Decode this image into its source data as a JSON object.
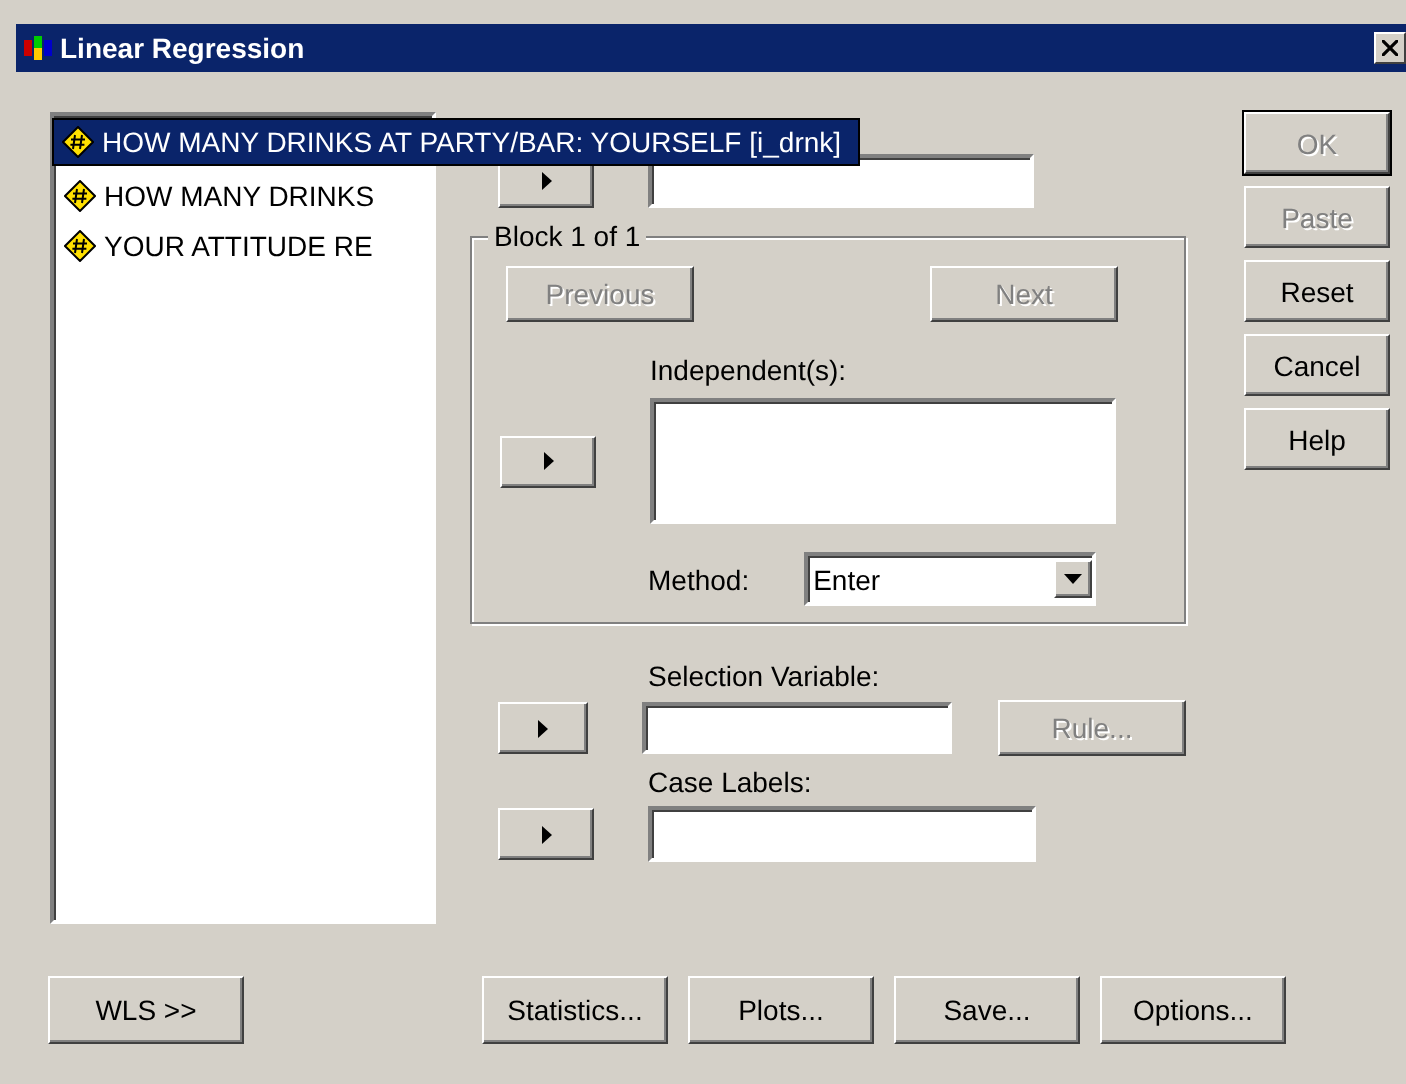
{
  "window": {
    "title": "Linear Regression"
  },
  "variables": [
    {
      "label": "HOW MANY DRINKS AT PARTY/BAR: YOURSELF [i_drnk]",
      "selected": true
    },
    {
      "label": "HOW MANY DRINKS",
      "selected": false
    },
    {
      "label": "YOUR ATTITUDE RE",
      "selected": false
    }
  ],
  "block": {
    "title": "Block 1 of 1",
    "previous": {
      "label": "Previous",
      "disabled": true
    },
    "next": {
      "label": "Next",
      "disabled": true
    },
    "independents_label": "Independent(s):",
    "method_label": "Method:",
    "method": "Enter"
  },
  "selection_variable": {
    "label": "Selection Variable:",
    "rule": {
      "label": "Rule...",
      "disabled": true
    }
  },
  "case_labels": {
    "label": "Case Labels:"
  },
  "side_buttons": [
    {
      "label": "OK",
      "disabled": true,
      "default": true
    },
    {
      "label": "Paste",
      "disabled": true,
      "default": false
    },
    {
      "label": "Reset",
      "disabled": false,
      "default": false
    },
    {
      "label": "Cancel",
      "disabled": false,
      "default": false
    },
    {
      "label": "Help",
      "disabled": false,
      "default": false
    }
  ],
  "wls_button": {
    "label": "WLS >>"
  },
  "bottom_buttons": [
    {
      "label": "Statistics..."
    },
    {
      "label": "Plots..."
    },
    {
      "label": "Save..."
    },
    {
      "label": "Options..."
    }
  ]
}
